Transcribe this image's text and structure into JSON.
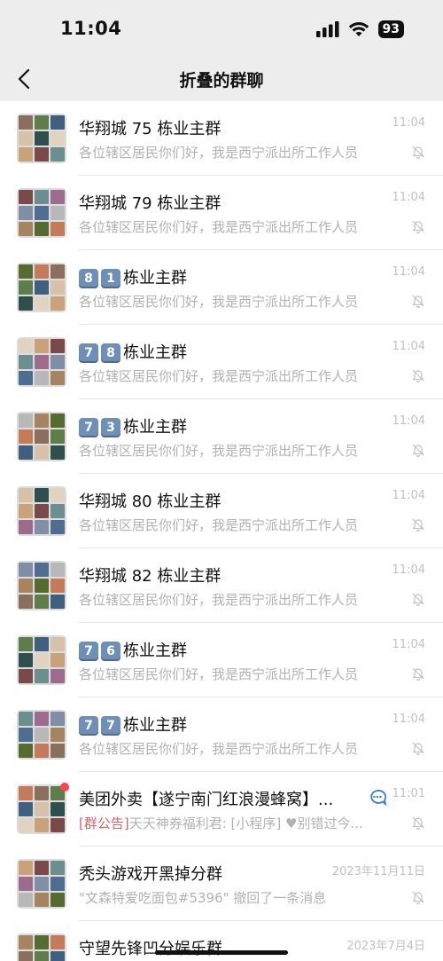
{
  "status_bar": {
    "time": "11:04",
    "battery": "93"
  },
  "nav": {
    "title": "折叠的群聊"
  },
  "chats": [
    {
      "name": "华翔城 75 栋业主群",
      "preview": "各位辖区居民你们好，我是西宁派出所工作人员",
      "time": "11:04",
      "muted": true
    },
    {
      "name": "华翔城 79 栋业主群",
      "preview": "各位辖区居民你们好，我是西宁派出所工作人员",
      "time": "11:04",
      "muted": true
    },
    {
      "badges": [
        "8",
        "1"
      ],
      "name": "栋业主群",
      "preview": "各位辖区居民你们好，我是西宁派出所工作人员",
      "time": "11:04",
      "muted": true
    },
    {
      "badges": [
        "7",
        "8"
      ],
      "name": "栋业主群",
      "preview": "各位辖区居民你们好，我是西宁派出所工作人员",
      "time": "11:04",
      "muted": true
    },
    {
      "badges": [
        "7",
        "3"
      ],
      "name": "栋业主群",
      "preview": "各位辖区居民你们好，我是西宁派出所工作人员",
      "time": "11:04",
      "muted": true
    },
    {
      "name": "华翔城 80 栋业主群",
      "preview": "各位辖区居民你们好，我是西宁派出所工作人员",
      "time": "11:04",
      "muted": true
    },
    {
      "name": "华翔城 82 栋业主群",
      "preview": "各位辖区居民你们好，我是西宁派出所工作人员",
      "time": "11:04",
      "muted": true
    },
    {
      "badges": [
        "7",
        "6"
      ],
      "name": "栋业主群",
      "preview": "各位辖区居民你们好，我是西宁派出所工作人员",
      "time": "11:04",
      "muted": true
    },
    {
      "badges": [
        "7",
        "7"
      ],
      "name": "栋业主群",
      "preview": "各位辖区居民你们好，我是西宁派出所工作人员",
      "time": "11:04",
      "muted": true
    },
    {
      "name": "美团外卖【遂宁南门红浪漫蜂窝】...",
      "tag": "[群公告]",
      "preview": "天天神券福利君: [小程序] ♥别错过今...",
      "time": "11:01",
      "muted": true,
      "unread": true,
      "mention": true
    },
    {
      "name": "秃头游戏开黑掉分群",
      "preview": "\"文森特爱吃面包#5396\" 撤回了一条消息",
      "time": "2023年11月11日",
      "muted": true
    },
    {
      "name": "守望先锋凹分娱乐群",
      "preview": "",
      "time": "2023年7月4日",
      "muted": false
    }
  ],
  "colors": {
    "background": "#ededed",
    "list_background": "#ffffff",
    "secondary_text": "#b2b2b2",
    "notice_tag": "#e06262",
    "unread_dot": "#ff4444",
    "badge_blue": "#6e8fb8"
  }
}
